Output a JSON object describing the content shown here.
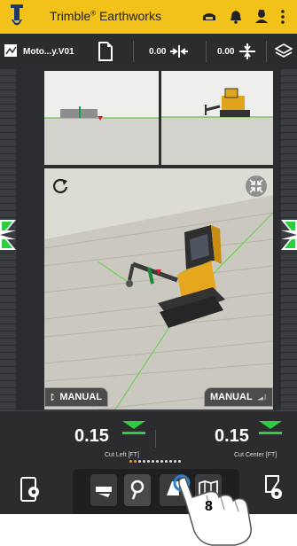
{
  "header": {
    "app_title": "Trimble",
    "app_title_suffix": "Earthworks",
    "registered": "®"
  },
  "toolbar": {
    "design_name": "Moto...y.V01",
    "offset_h_value": "0.00",
    "offset_v_value": "0.00"
  },
  "viewport": {
    "left_mode_label": "MANUAL",
    "right_mode_label": "MANUAL"
  },
  "readouts": {
    "left_value": "0.15",
    "left_label": "Cut Left  [FT]",
    "right_value": "0.15",
    "right_label": "Cut Center  [FT]"
  },
  "gesture": {
    "step_number": "8"
  },
  "colors": {
    "header_bg": "#f2c21a",
    "dark_bg": "#2c2c2e",
    "cut_indicator": "#2ecc40",
    "page_dot_active": "#f39a1e"
  }
}
